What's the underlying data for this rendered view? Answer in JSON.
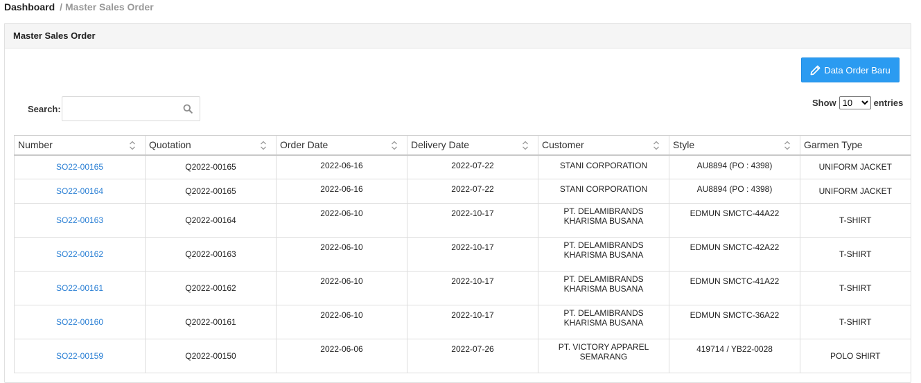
{
  "breadcrumb": {
    "root": "Dashboard",
    "separator": "/",
    "current": "Master Sales Order"
  },
  "panel": {
    "title": "Master Sales Order"
  },
  "toolbar": {
    "new_order_label": "Data Order Baru"
  },
  "search": {
    "label": "Search:",
    "value": "",
    "placeholder": ""
  },
  "page_size": {
    "prefix": "Show",
    "selected": "10",
    "suffix": "entries"
  },
  "table": {
    "columns": [
      "Number",
      "Quotation",
      "Order Date",
      "Delivery Date",
      "Customer",
      "Style",
      "Garmen Type"
    ],
    "rows": [
      {
        "number": "SO22-00165",
        "quotation": "Q2022-00165",
        "order_date": "2022-06-16",
        "delivery_date": "2022-07-22",
        "customer": "STANI CORPORATION",
        "style": "AU8894 (PO : 4398)",
        "garment_type": "UNIFORM JACKET"
      },
      {
        "number": "SO22-00164",
        "quotation": "Q2022-00165",
        "order_date": "2022-06-16",
        "delivery_date": "2022-07-22",
        "customer": "STANI CORPORATION",
        "style": "AU8894 (PO : 4398)",
        "garment_type": "UNIFORM JACKET"
      },
      {
        "number": "SO22-00163",
        "quotation": "Q2022-00164",
        "order_date": "2022-06-10",
        "delivery_date": "2022-10-17",
        "customer": "PT. DELAMIBRANDS KHARISMA BUSANA",
        "style": "EDMUN SMCTC-44A22",
        "garment_type": "T-SHIRT"
      },
      {
        "number": "SO22-00162",
        "quotation": "Q2022-00163",
        "order_date": "2022-06-10",
        "delivery_date": "2022-10-17",
        "customer": "PT. DELAMIBRANDS KHARISMA BUSANA",
        "style": "EDMUN SMCTC-42A22",
        "garment_type": "T-SHIRT"
      },
      {
        "number": "SO22-00161",
        "quotation": "Q2022-00162",
        "order_date": "2022-06-10",
        "delivery_date": "2022-10-17",
        "customer": "PT. DELAMIBRANDS KHARISMA BUSANA",
        "style": "EDMUN SMCTC-41A22",
        "garment_type": "T-SHIRT"
      },
      {
        "number": "SO22-00160",
        "quotation": "Q2022-00161",
        "order_date": "2022-06-10",
        "delivery_date": "2022-10-17",
        "customer": "PT. DELAMIBRANDS KHARISMA BUSANA",
        "style": "EDMUN SMCTC-36A22",
        "garment_type": "T-SHIRT"
      },
      {
        "number": "SO22-00159",
        "quotation": "Q2022-00150",
        "order_date": "2022-06-06",
        "delivery_date": "2022-07-26",
        "customer": "PT. VICTORY APPAREL SEMARANG",
        "style": "419714 / YB22-0028",
        "garment_type": "POLO SHIRT"
      }
    ]
  },
  "colors": {
    "primary_button": "#2b9bf1",
    "link": "#2a7fd4",
    "panel_header_bg": "#f5f5f5"
  },
  "icons": {
    "new_order": "pencil-icon",
    "search": "search-icon",
    "sort": "sort-icon"
  }
}
